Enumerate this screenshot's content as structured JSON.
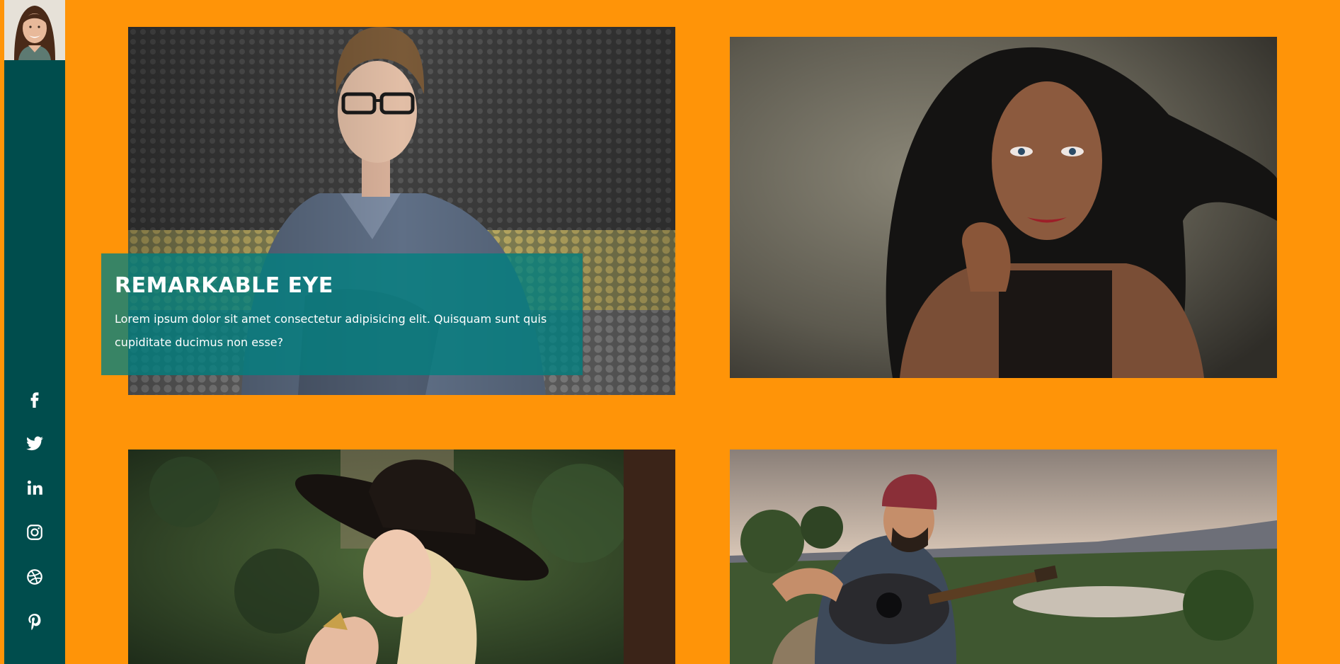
{
  "colors": {
    "background": "#ff9408",
    "sidebar": "#004d4d",
    "caption_overlay": "#008080"
  },
  "sidebar": {
    "avatar": "avatar-photo",
    "social": [
      {
        "name": "facebook-icon",
        "glyph": "f"
      },
      {
        "name": "twitter-icon",
        "glyph": "bird"
      },
      {
        "name": "linkedin-icon",
        "glyph": "in"
      },
      {
        "name": "instagram-icon",
        "glyph": "camera"
      },
      {
        "name": "dribbble-icon",
        "glyph": "ball"
      },
      {
        "name": "pinterest-icon",
        "glyph": "p"
      }
    ]
  },
  "gallery": {
    "featured": {
      "title": "REMARKABLE EYE",
      "text": "Lorem ipsum dolor sit amet consectetur adipisicing elit. Quisquam sunt quis cupiditate ducimus non esse?"
    },
    "photos": [
      "man-reading-photo",
      "woman-portrait-photo",
      "woman-in-hat-photo",
      "man-with-guitar-photo"
    ]
  }
}
